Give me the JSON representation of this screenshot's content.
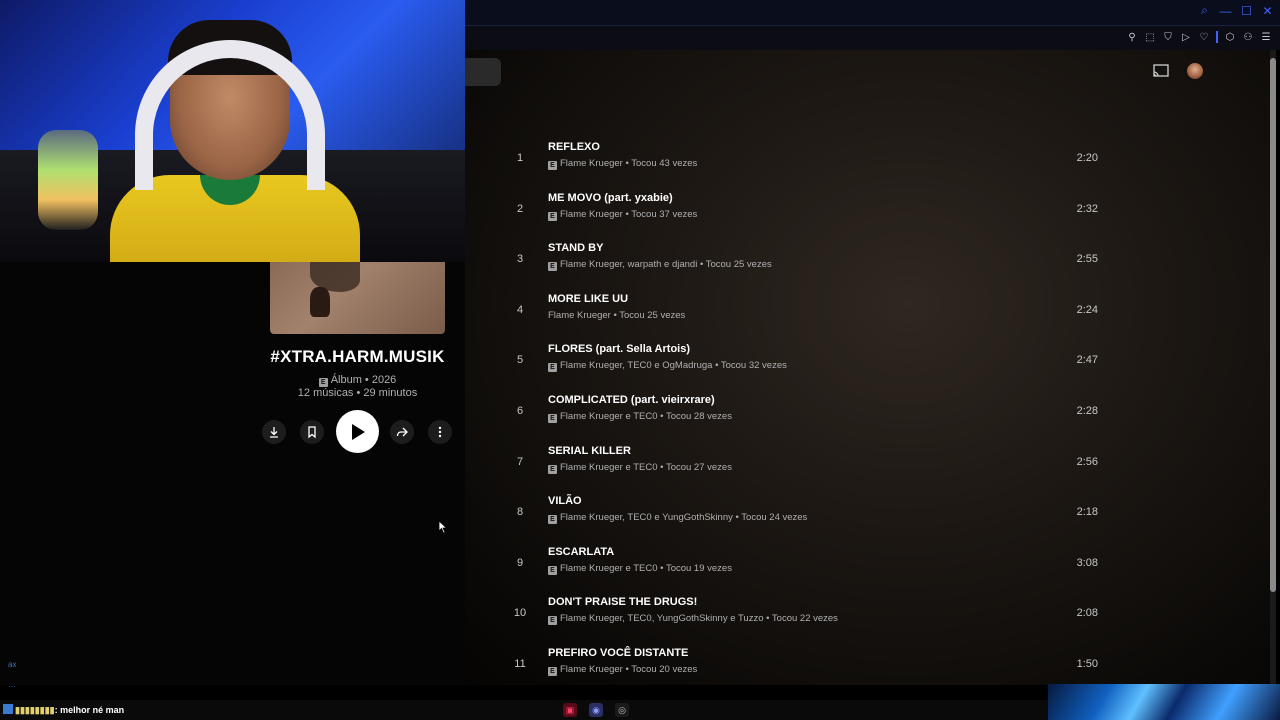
{
  "album": {
    "title": "#XTRA.HARM.MUSIK",
    "explicit": "E",
    "type_year": "Álbum • 2026",
    "counts": "12 músicas • 29 minutos"
  },
  "actions": {
    "download": "download-icon",
    "save": "bookmark-icon",
    "play": "play-icon",
    "share": "share-icon",
    "more": "more-vert-icon"
  },
  "tracks": [
    {
      "num": "1",
      "title": "REFLEXO",
      "sub": "Flame Krueger • Tocou 43 vezes",
      "dur": "2:20",
      "explicit": true
    },
    {
      "num": "2",
      "title": "ME MOVO (part. yxabie)",
      "sub": "Flame Krueger • Tocou 37 vezes",
      "dur": "2:32",
      "explicit": true
    },
    {
      "num": "3",
      "title": "STAND BY",
      "sub": "Flame Krueger, warpath e djandi • Tocou 25 vezes",
      "dur": "2:55",
      "explicit": true
    },
    {
      "num": "4",
      "title": "MORE LIKE UU",
      "sub": "Flame Krueger • Tocou 25 vezes",
      "dur": "2:24",
      "explicit": false
    },
    {
      "num": "5",
      "title": "FLORES (part. Sella Artois)",
      "sub": "Flame Krueger, TEC0 e OgMadruga • Tocou 32 vezes",
      "dur": "2:47",
      "explicit": true
    },
    {
      "num": "6",
      "title": "COMPLICATED (part. vieirxrare)",
      "sub": "Flame Krueger e TEC0 • Tocou 28 vezes",
      "dur": "2:28",
      "explicit": true
    },
    {
      "num": "7",
      "title": "SERIAL KILLER",
      "sub": "Flame Krueger e TEC0 • Tocou 27 vezes",
      "dur": "2:56",
      "explicit": true
    },
    {
      "num": "8",
      "title": "VILÃO",
      "sub": "Flame Krueger, TEC0 e YungGothSkinny • Tocou 24 vezes",
      "dur": "2:18",
      "explicit": true
    },
    {
      "num": "9",
      "title": "ESCARLATA",
      "sub": "Flame Krueger e TEC0 • Tocou 19 vezes",
      "dur": "3:08",
      "explicit": true
    },
    {
      "num": "10",
      "title": "DON'T PRAISE THE DRUGS!",
      "sub": "Flame Krueger, TEC0, YungGothSkinny e Tuzzo • Tocou 22 vezes",
      "dur": "2:08",
      "explicit": true
    },
    {
      "num": "11",
      "title": "PREFIRO VOCÊ DISTANTE",
      "sub": "Flame Krueger • Tocou 20 vezes",
      "dur": "1:50",
      "explicit": true
    }
  ],
  "chat": {
    "message": ": melhor né man"
  },
  "taskbar_icons": [
    "app-icon",
    "discord-icon",
    "chrome-icon"
  ],
  "colors": {
    "accent": "#3f63ff",
    "play_button": "#ffffff"
  }
}
